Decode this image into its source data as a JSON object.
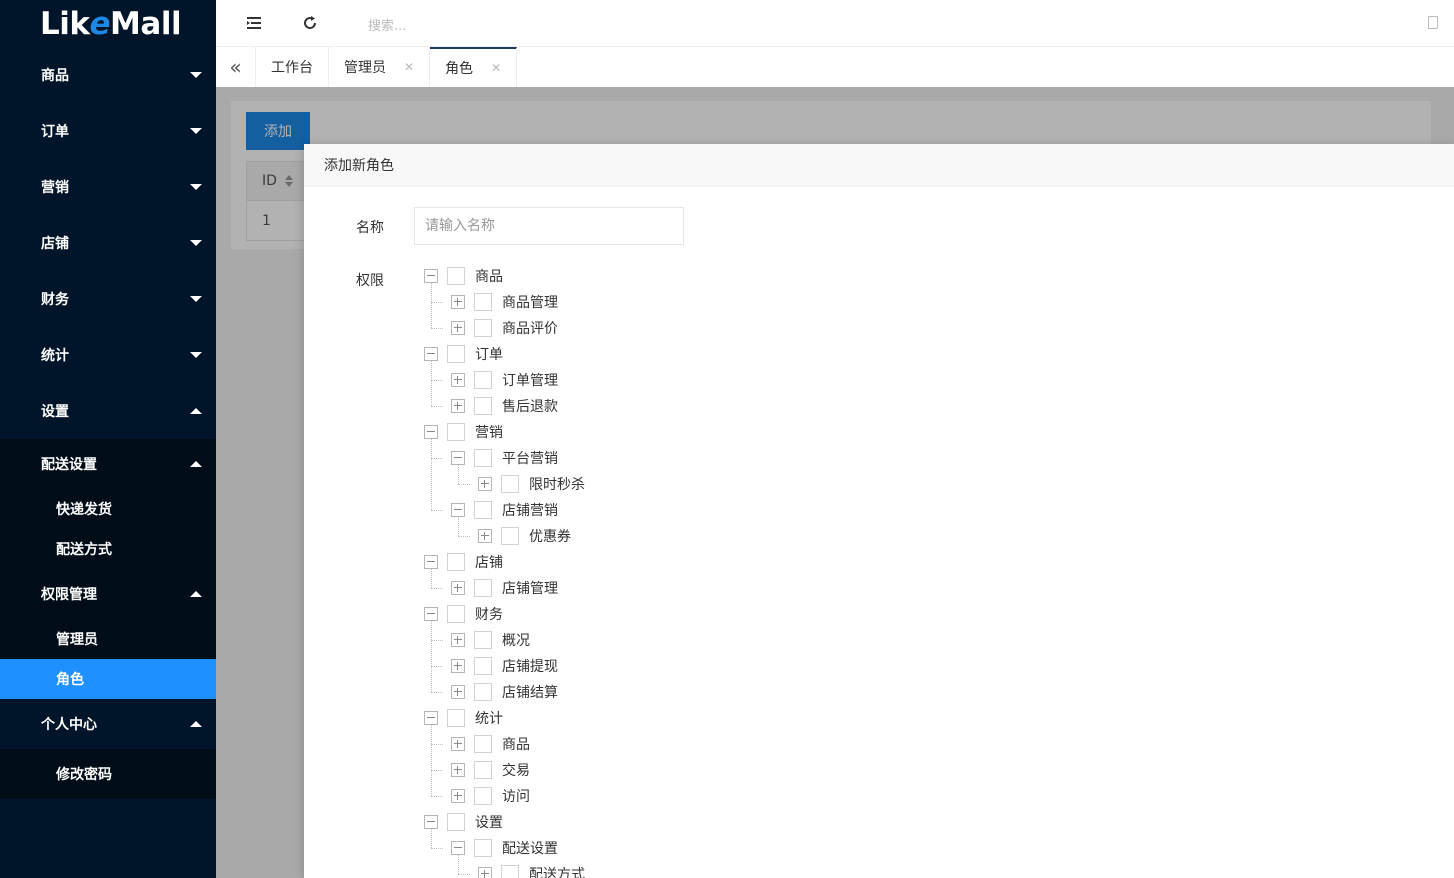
{
  "app": {
    "logo_left": "Li",
    "logo_k": "k",
    "logo_e": "e",
    "logo_right": "Mall"
  },
  "sidebar": {
    "menu": [
      {
        "label": "商品",
        "open": false
      },
      {
        "label": "订单",
        "open": false
      },
      {
        "label": "营销",
        "open": false
      },
      {
        "label": "店铺",
        "open": false
      },
      {
        "label": "财务",
        "open": false
      },
      {
        "label": "统计",
        "open": false
      },
      {
        "label": "设置",
        "open": true
      }
    ],
    "settings_sub": [
      {
        "label": "配送设置",
        "children": [
          "快递发货",
          "配送方式"
        ]
      },
      {
        "label": "权限管理",
        "children": [
          "管理员",
          "角色"
        ]
      }
    ],
    "personal": {
      "label": "个人中心",
      "children": [
        "修改密码"
      ]
    },
    "active_item": "角色"
  },
  "header": {
    "search_placeholder": "搜索..."
  },
  "tabs": [
    {
      "label": "工作台",
      "closable": false,
      "active": false
    },
    {
      "label": "管理员",
      "closable": true,
      "active": false
    },
    {
      "label": "角色",
      "closable": true,
      "active": true
    }
  ],
  "content": {
    "add_label": "添加",
    "table": {
      "col_id": "ID",
      "row_id": "1"
    }
  },
  "modal": {
    "title": "添加新角色",
    "name_label": "名称",
    "name_placeholder": "请输入名称",
    "perm_label": "权限",
    "tree": [
      {
        "level": 1,
        "label": "商品",
        "expanded": true
      },
      {
        "level": 2,
        "label": "商品管理",
        "expanded": false
      },
      {
        "level": 2,
        "label": "商品评价",
        "expanded": false
      },
      {
        "level": 1,
        "label": "订单",
        "expanded": true
      },
      {
        "level": 2,
        "label": "订单管理",
        "expanded": false
      },
      {
        "level": 2,
        "label": "售后退款",
        "expanded": false
      },
      {
        "level": 1,
        "label": "营销",
        "expanded": true
      },
      {
        "level": 2,
        "label": "平台营销",
        "expanded": true
      },
      {
        "level": 3,
        "label": "限时秒杀",
        "expanded": false
      },
      {
        "level": 2,
        "label": "店铺营销",
        "expanded": true
      },
      {
        "level": 3,
        "label": "优惠券",
        "expanded": false
      },
      {
        "level": 1,
        "label": "店铺",
        "expanded": true
      },
      {
        "level": 2,
        "label": "店铺管理",
        "expanded": false
      },
      {
        "level": 1,
        "label": "财务",
        "expanded": true
      },
      {
        "level": 2,
        "label": "概况",
        "expanded": false
      },
      {
        "level": 2,
        "label": "店铺提现",
        "expanded": false
      },
      {
        "level": 2,
        "label": "店铺结算",
        "expanded": false
      },
      {
        "level": 1,
        "label": "统计",
        "expanded": true
      },
      {
        "level": 2,
        "label": "商品",
        "expanded": false
      },
      {
        "level": 2,
        "label": "交易",
        "expanded": false
      },
      {
        "level": 2,
        "label": "访问",
        "expanded": false
      },
      {
        "level": 1,
        "label": "设置",
        "expanded": true
      },
      {
        "level": 2,
        "label": "配送设置",
        "expanded": true
      },
      {
        "level": 3,
        "label": "配送方式",
        "expanded": false
      }
    ]
  }
}
